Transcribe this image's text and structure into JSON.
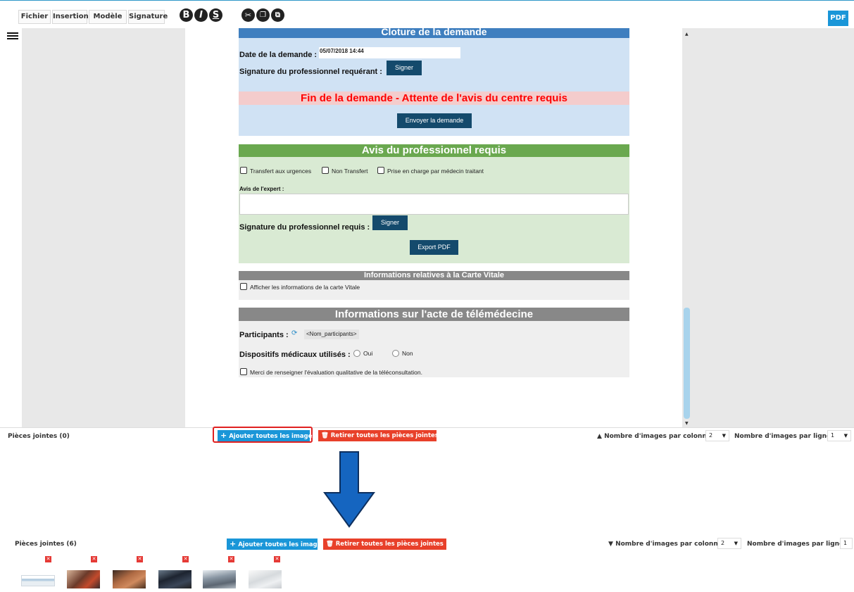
{
  "toolbar": {
    "menu": [
      "Fichier",
      "Insertion",
      "Modèle",
      "Signature"
    ],
    "pdf_label": "PDF"
  },
  "cloture": {
    "title": "Cloture de la demande",
    "date_label": "Date de la demande :",
    "date_value": "05/07/2018 14:44",
    "signature_label": "Signature du professionnel requérant :",
    "sign_button": "Signer",
    "status_banner": "Fin de la demande - Attente de l'avis du centre requis",
    "send_button": "Envoyer la demande"
  },
  "avis": {
    "title": "Avis du professionnel requis",
    "options": [
      "Transfert aux urgences",
      "Non Transfert",
      "Prise en charge par médecin traitant"
    ],
    "expert_label": "Avis de l'expert :",
    "signature_label": "Signature du professionnel requis :",
    "sign_button": "Signer",
    "export_button": "Export PDF"
  },
  "vitale": {
    "title": "Informations relatives à la Carte Vitale",
    "checkbox_label": "Afficher les informations de la carte Vitale"
  },
  "acte": {
    "title": "Informations sur l'acte de télémédecine",
    "participants_label": "Participants :",
    "participants_value": "<Nom_participants>",
    "dispositifs_label": "Dispositifs médicaux utilisés :",
    "oui": "Oui",
    "non": "Non",
    "evaluation_label": "Merci de renseigner l'évaluation qualitative de la téléconsultation."
  },
  "attachments_before": {
    "title": "Pièces jointes (0)",
    "add_button": "Ajouter toutes les images",
    "remove_button": "Retirer toutes les pièces jointes",
    "per_column_label": "Nombre d'images par colonne :",
    "per_column_value": "2",
    "per_row_label": "Nombre d'images par ligne :",
    "per_row_value": "1"
  },
  "attachments_after": {
    "title": "Pièces jointes (6)",
    "add_button": "Ajouter toutes les images",
    "remove_button": "Retirer toutes les pièces jointes",
    "per_column_label": "Nombre d'images par colonne :",
    "per_column_value": "2",
    "per_row_label": "Nombre d'images par ligne :",
    "per_row_value": "1",
    "thumbnails": [
      "document-thumbnail",
      "photo-thumbnail",
      "photo-thumbnail",
      "photo-thumbnail",
      "photo-thumbnail",
      "photo-thumbnail"
    ]
  },
  "colors": {
    "accent_blue": "#1a96d8",
    "danger_red": "#e8402a",
    "cloture_header": "#3f7fbf",
    "cloture_bg": "#d0e2f4",
    "avis_header": "#6aa84f",
    "avis_bg": "#d9ead3",
    "gray_header": "#888888",
    "arrow_blue": "#1565c0"
  }
}
